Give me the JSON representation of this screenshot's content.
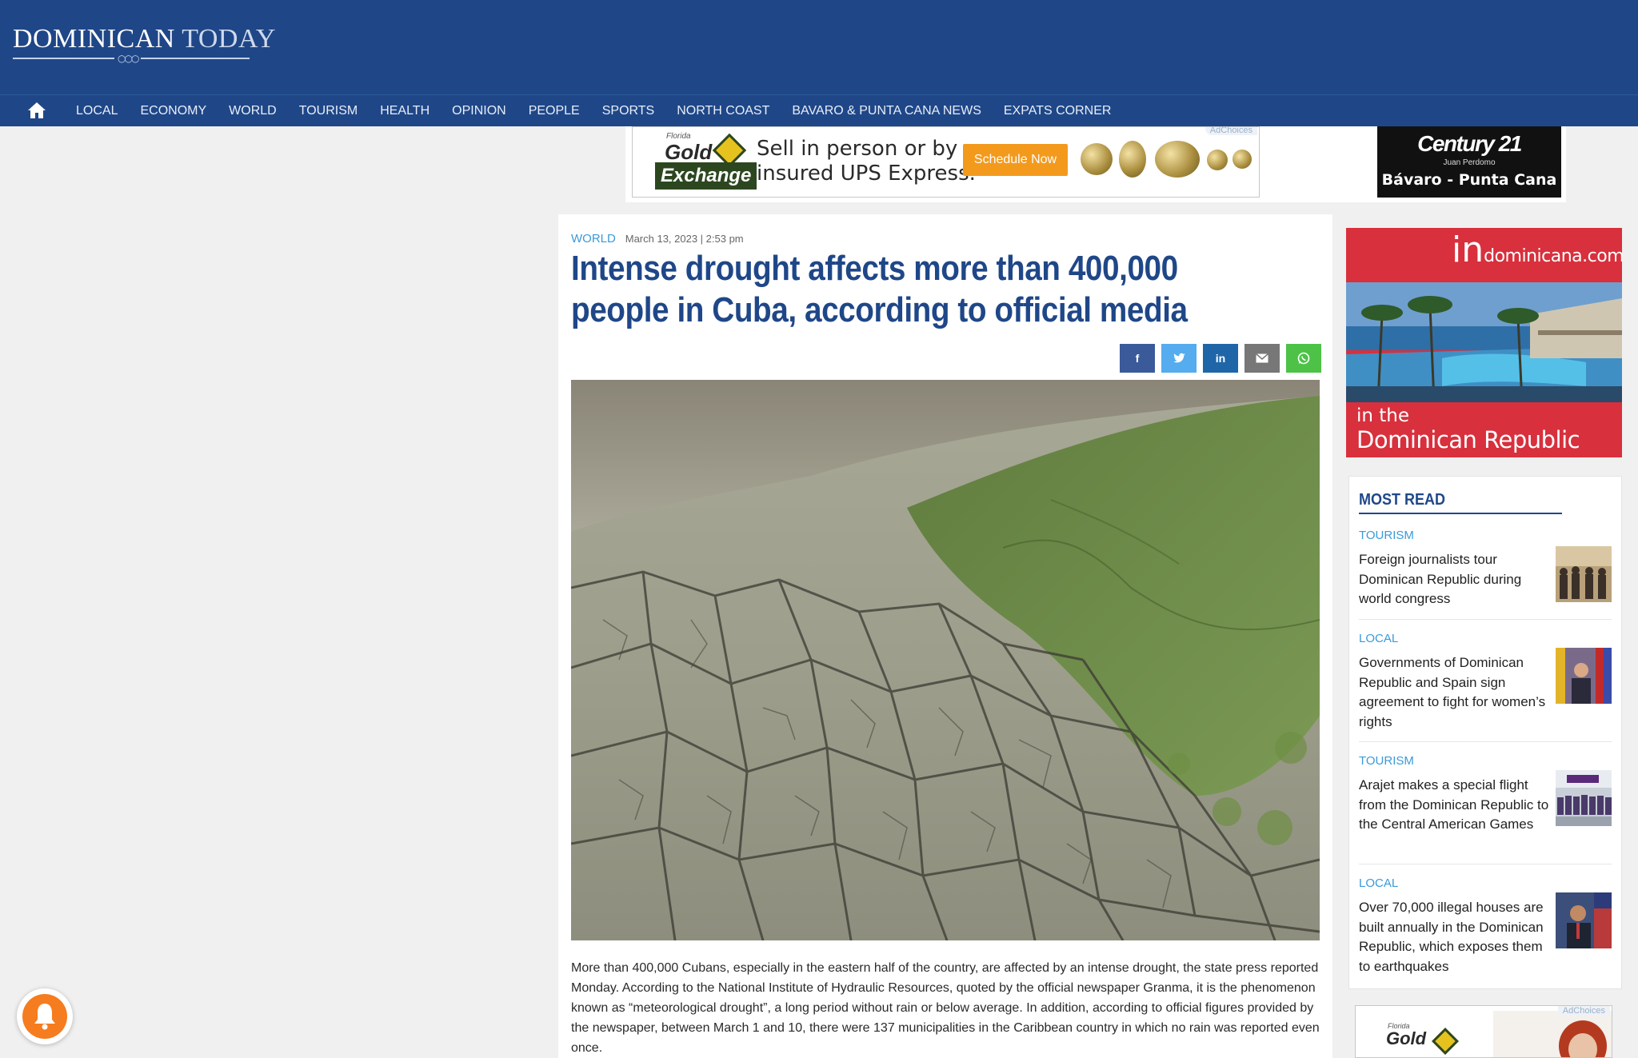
{
  "header": {
    "logo_bold": "DOMINICAN",
    "logo_light": "TODAY",
    "logo_rings": "○○○"
  },
  "nav": {
    "home_icon": "home-icon",
    "items": [
      "LOCAL",
      "ECONOMY",
      "WORLD",
      "TOURISM",
      "HEALTH",
      "OPINION",
      "PEOPLE",
      "SPORTS",
      "NORTH COAST",
      "BAVARO & PUNTA CANA NEWS",
      "EXPATS CORNER"
    ]
  },
  "ads": {
    "gold_exchange": {
      "small": "Florida",
      "brand_line1": "Gold",
      "brand_line2": "Exchange",
      "text_line1": "Sell in person or by",
      "text_line2": "insured UPS Express.",
      "button": "Schedule Now",
      "adchoices": "AdChoices"
    },
    "century21": {
      "main": "Century 21",
      "sub": "Juan Perdomo",
      "location": "Bávaro - Punta Cana"
    },
    "indominicana": {
      "logo_big": "in",
      "logo_small": "dominicana.com",
      "line1": "in the",
      "line2": "Dominican Republic"
    },
    "bottom": {
      "small": "Florida",
      "brand": "Gold",
      "adchoices": "AdChoices"
    }
  },
  "article": {
    "category": "WORLD",
    "date": "March 13, 2023 | 2:53 pm",
    "headline": "Intense drought affects more than 400,000 people in Cuba, according to official media",
    "share": [
      {
        "icon": "facebook-icon",
        "glyph": "f",
        "color": "#3b5a9a"
      },
      {
        "icon": "twitter-icon",
        "glyph": "🐦",
        "color": "#55acee"
      },
      {
        "icon": "linkedin-icon",
        "glyph": "in",
        "color": "#1f66a8"
      },
      {
        "icon": "email-icon",
        "glyph": "✉",
        "color": "#777777"
      },
      {
        "icon": "whatsapp-icon",
        "glyph": "◯",
        "color": "#4dc247"
      }
    ],
    "body": "More than 400,000 Cubans, especially in the eastern half of the country, are affected by an intense drought, the state press reported Monday. According to the National Institute of Hydraulic Resources, quoted by the official newspaper Granma, it is the phenomenon known as “meteorological drought”, a long period without rain or below average. In addition, according to official figures provided by the newspaper, between March 1 and 10, there were 137 municipalities in the Caribbean country in which no rain was reported even once."
  },
  "most_read": {
    "title": "MOST READ",
    "items": [
      {
        "category": "TOURISM",
        "title": "Foreign journalists tour Dominican Republic during world congress"
      },
      {
        "category": "LOCAL",
        "title": "Governments of Dominican Republic and Spain sign agreement to fight for women’s rights"
      },
      {
        "category": "TOURISM",
        "title": "Arajet makes a special flight from the Dominican Republic to the Central American Games"
      },
      {
        "category": "LOCAL",
        "title": "Over 70,000 illegal houses are built annually in the Dominican Republic, which exposes them to earthquakes"
      }
    ]
  },
  "colors": {
    "brand_blue": "#1f4788",
    "link_blue": "#3a9ad9",
    "accent_orange": "#f39a1d"
  }
}
